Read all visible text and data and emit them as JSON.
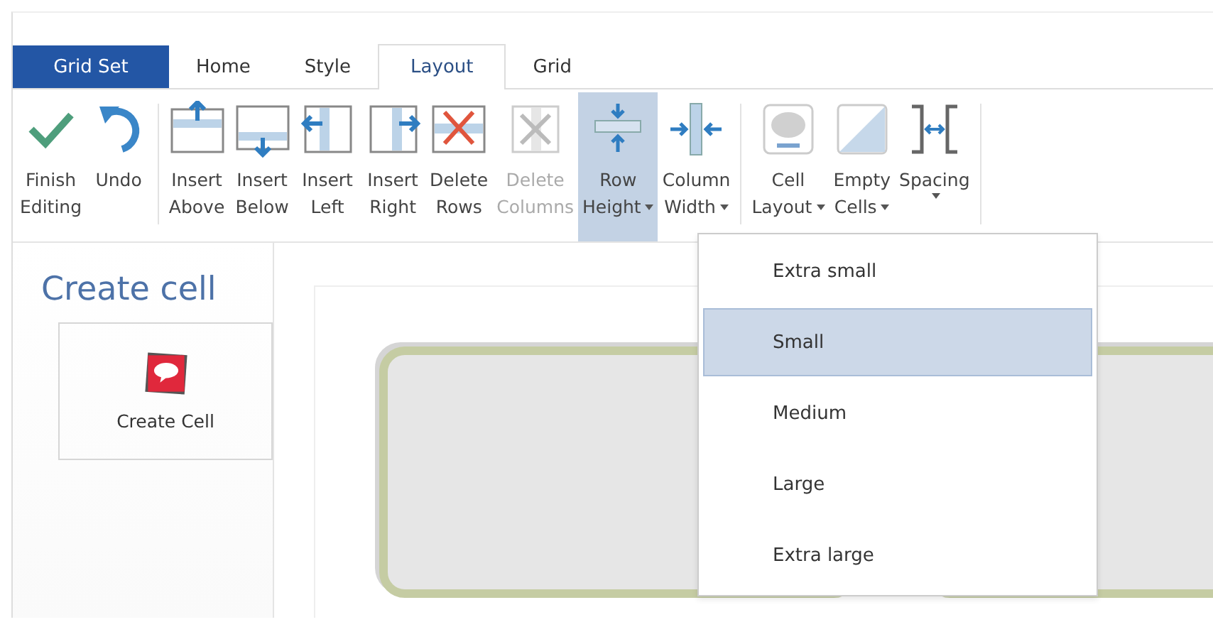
{
  "app_tab": {
    "label": "Grid Set"
  },
  "tabs": [
    {
      "label": "Home",
      "selected": false
    },
    {
      "label": "Style",
      "selected": false
    },
    {
      "label": "Layout",
      "selected": true
    },
    {
      "label": "Grid",
      "selected": false
    }
  ],
  "ribbon_groups": [
    {
      "buttons": [
        {
          "kind": "check",
          "lines": [
            "Finish",
            "Editing"
          ],
          "disabled": false,
          "selected": false,
          "dropdown": false
        },
        {
          "kind": "undo",
          "lines": [
            "Undo"
          ],
          "disabled": false,
          "selected": false,
          "dropdown": false
        }
      ]
    },
    {
      "buttons": [
        {
          "kind": "insert-above",
          "lines": [
            "Insert",
            "Above"
          ],
          "disabled": false,
          "selected": false,
          "dropdown": false
        },
        {
          "kind": "insert-below",
          "lines": [
            "Insert",
            "Below"
          ],
          "disabled": false,
          "selected": false,
          "dropdown": false
        },
        {
          "kind": "insert-left",
          "lines": [
            "Insert",
            "Left"
          ],
          "disabled": false,
          "selected": false,
          "dropdown": false
        },
        {
          "kind": "insert-right",
          "lines": [
            "Insert",
            "Right"
          ],
          "disabled": false,
          "selected": false,
          "dropdown": false
        },
        {
          "kind": "delete-rows",
          "lines": [
            "Delete",
            "Rows"
          ],
          "disabled": false,
          "selected": false,
          "dropdown": false
        },
        {
          "kind": "delete-columns",
          "lines": [
            "Delete",
            "Columns"
          ],
          "disabled": true,
          "selected": false,
          "dropdown": false
        },
        {
          "kind": "row-height",
          "lines": [
            "Row",
            "Height"
          ],
          "disabled": false,
          "selected": true,
          "dropdown": true
        },
        {
          "kind": "column-width",
          "lines": [
            "Column",
            "Width"
          ],
          "disabled": false,
          "selected": false,
          "dropdown": true
        }
      ]
    },
    {
      "buttons": [
        {
          "kind": "cell-layout",
          "lines": [
            "Cell",
            "Layout"
          ],
          "disabled": false,
          "selected": false,
          "dropdown": true
        },
        {
          "kind": "empty-cells",
          "lines": [
            "Empty",
            "Cells"
          ],
          "disabled": false,
          "selected": false,
          "dropdown": true
        },
        {
          "kind": "spacing",
          "lines": [
            "Spacing"
          ],
          "disabled": false,
          "selected": false,
          "dropdown": true
        }
      ]
    }
  ],
  "sidebar": {
    "heading": "Create cell",
    "create_button": {
      "label": "Create Cell"
    }
  },
  "row_height_menu": [
    {
      "label": "Extra small",
      "selected": false
    },
    {
      "label": "Small",
      "selected": true
    },
    {
      "label": "Medium",
      "selected": false
    },
    {
      "label": "Large",
      "selected": false
    },
    {
      "label": "Extra large",
      "selected": false
    }
  ]
}
